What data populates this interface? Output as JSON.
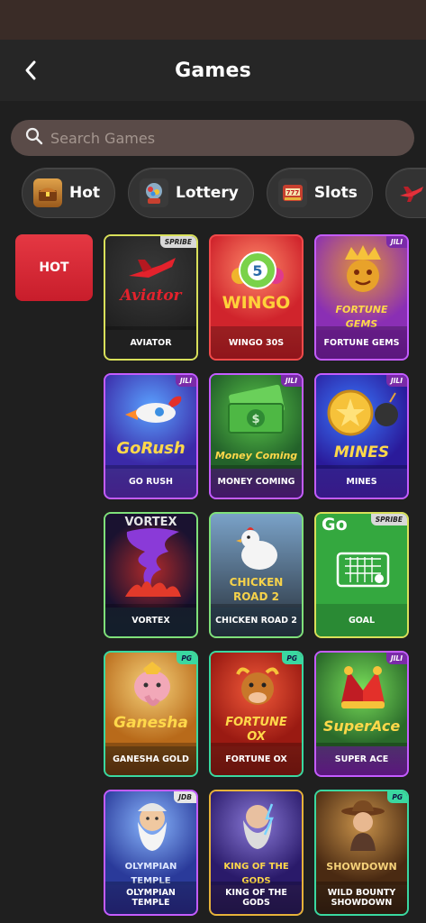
{
  "header": {
    "title": "Games"
  },
  "search": {
    "placeholder": "Search Games"
  },
  "chips": [
    {
      "label": "Hot",
      "icon": "treasure-chest-icon"
    },
    {
      "label": "Lottery",
      "icon": "lottery-machine-icon"
    },
    {
      "label": "Slots",
      "icon": "slot-machine-icon"
    },
    {
      "label": "",
      "icon": "airplane-icon"
    }
  ],
  "sidebar": {
    "hot_label": "HOT"
  },
  "games": [
    {
      "name": "AVIATOR",
      "brand": "SPRIBE",
      "logo": "Aviator"
    },
    {
      "name": "WINGO 30S",
      "brand": "",
      "logo": "WINGO"
    },
    {
      "name": "FORTUNE GEMS",
      "brand": "JILI",
      "logo": "FORTUNE GEMS"
    },
    {
      "name": "GO RUSH",
      "brand": "JILI",
      "logo": "GoRush"
    },
    {
      "name": "MONEY COMING",
      "brand": "JILI",
      "logo": "Money Coming"
    },
    {
      "name": "MINES",
      "brand": "JILI",
      "logo": "MINES"
    },
    {
      "name": "VORTEX",
      "brand": "",
      "logo": "VORTEX"
    },
    {
      "name": "CHICKEN ROAD 2",
      "brand": "",
      "logo": "CHICKEN ROAD 2"
    },
    {
      "name": "GOAL",
      "brand": "SPRIBE",
      "logo": "Go"
    },
    {
      "name": "GANESHA GOLD",
      "brand": "PG",
      "logo": "Ganesha"
    },
    {
      "name": "FORTUNE OX",
      "brand": "PG",
      "logo": "FORTUNE OX"
    },
    {
      "name": "SUPER ACE",
      "brand": "JILI",
      "logo": "SuperAce"
    },
    {
      "name": "OLYMPIAN TEMPLE",
      "brand": "JDB",
      "logo": "OLYMPIAN TEMPLE"
    },
    {
      "name": "KING OF THE GODS",
      "brand": "",
      "logo": "KING OF THE GODS"
    },
    {
      "name": "WILD BOUNTY SHOWDOWN",
      "brand": "PG",
      "logo": "SHOWDOWN"
    }
  ],
  "colors": {
    "accent_red": "#d92a36",
    "header_bg": "#262626",
    "search_bg": "#5a4b48"
  }
}
